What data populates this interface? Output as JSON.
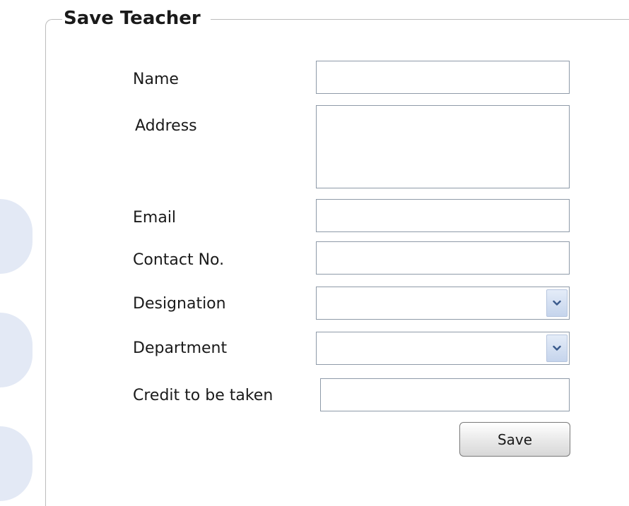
{
  "form": {
    "title": "Save Teacher",
    "fields": {
      "name": {
        "label": "Name",
        "value": ""
      },
      "address": {
        "label": "Address",
        "value": ""
      },
      "email": {
        "label": "Email",
        "value": ""
      },
      "contact": {
        "label": "Contact No.",
        "value": ""
      },
      "designation": {
        "label": "Designation",
        "selected": ""
      },
      "department": {
        "label": "Department",
        "selected": ""
      },
      "credit": {
        "label": "Credit to be taken",
        "value": ""
      }
    },
    "save_label": "Save"
  },
  "icons": {
    "dropdown": "chevron-down-icon"
  },
  "colors": {
    "background_shapes": "#e3e9f5",
    "dropdown_button": "#c5d4ec",
    "arrow": "#3a5a8c"
  }
}
